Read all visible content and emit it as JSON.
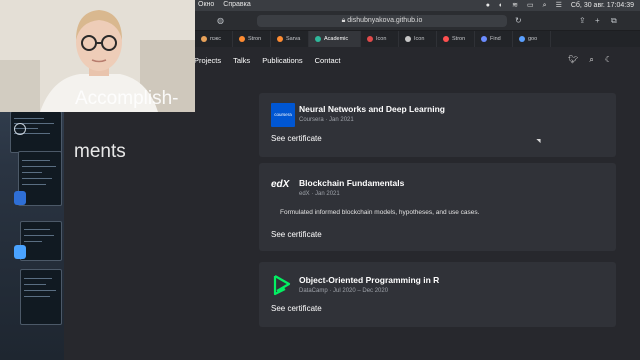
{
  "menubar": {
    "items": [
      "Окно",
      "Справка"
    ],
    "date_time": "Сб, 30 авг. 17:04:39",
    "status_icons": [
      "record-icon",
      "volume-icon",
      "wifi-icon",
      "battery-icon",
      "search-icon",
      "control-center-icon"
    ]
  },
  "browser": {
    "url": "dishubnyakova.github.io",
    "tabs": [
      {
        "label": "пэкс",
        "color": "#e8a25a"
      },
      {
        "label": "Stron",
        "color": "#ff8c32"
      },
      {
        "label": "Sarva",
        "color": "#ff8c32"
      },
      {
        "label": "Academic",
        "color": "#2fb89b",
        "active": true
      },
      {
        "label": "Icon",
        "color": "#e04a4a"
      },
      {
        "label": "Icon",
        "color": "#c7c7c7"
      },
      {
        "label": "Stron",
        "color": "#ff5050"
      },
      {
        "label": "Find",
        "color": "#6b8cff"
      },
      {
        "label": "goo",
        "color": "#5aa0ff"
      }
    ]
  },
  "site": {
    "nav": [
      "Projects",
      "Talks",
      "Publications",
      "Contact"
    ],
    "nav_icons": [
      "twitter-icon",
      "search-icon",
      "moon-icon"
    ],
    "heading_line1": "Accomplish-",
    "heading_line2": "ments",
    "cards": [
      {
        "title": "Neural Networks and Deep Learning",
        "issuer": "Coursera",
        "date": "Jan 2021",
        "description": "",
        "link": "See certificate",
        "logo": "coursera"
      },
      {
        "title": "Blockchain Fundamentals",
        "issuer": "edX",
        "date": "Jan 2021",
        "description": "Formulated informed blockchain models, hypotheses, and use cases.",
        "link": "See certificate",
        "logo": "edX"
      },
      {
        "title": "Object-Oriented Programming in R",
        "issuer": "DataCamp",
        "date": "Jul 2020 – Dec 2020",
        "description": "",
        "link": "See certificate",
        "logo": "datacamp"
      }
    ]
  },
  "colors": {
    "site_bg": "#27282d",
    "card_bg": "#303238",
    "coursera": "#0056d2",
    "datacamp": "#03ef62"
  }
}
